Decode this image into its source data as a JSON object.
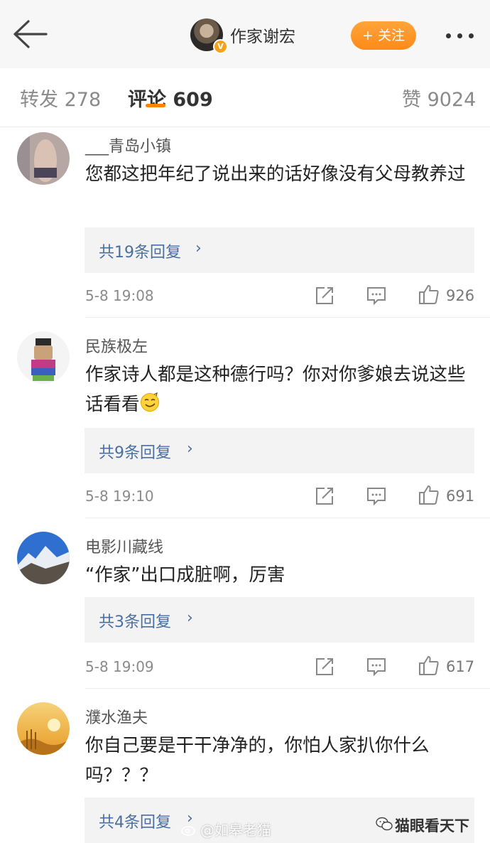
{
  "header": {
    "author_name": "作家谢宏",
    "verified_badge": "V",
    "follow_label": "+ 关注",
    "back_icon": "back-arrow-icon",
    "more_icon": "more-dots-icon"
  },
  "tabs": [
    {
      "label": "转发 278"
    },
    {
      "label": "评论 609"
    },
    {
      "label": "赞 9024"
    }
  ],
  "comments": [
    {
      "user": "___青岛小镇",
      "text": "您都这把年纪了说出来的话好像没有父母教养过",
      "replies": "共19条回复",
      "time": "5-8 19:08",
      "likes": "926"
    },
    {
      "user": "民族极左",
      "text": "作家诗人都是这种德行吗？你对你爹娘去说这些话看看",
      "replies": "共9条回复",
      "time": "5-8 19:10",
      "likes": "691"
    },
    {
      "user": "电影川藏线",
      "text": "“作家”出口成脏啊，厉害",
      "replies": "共3条回复",
      "time": "5-8 19:09",
      "likes": "617"
    },
    {
      "user": "濮水渔夫",
      "text": "你自己要是干干净净的，你怕人家扒你什么吗？？？",
      "replies": "共4条回复",
      "time": "",
      "likes": ""
    }
  ],
  "reply_chevron": "›",
  "watermarks": {
    "left": "@如皋老猫",
    "right": "猫眼看天下"
  },
  "colors": {
    "accent_orange": "#ff8200",
    "link_blue": "#4a6fa1"
  }
}
